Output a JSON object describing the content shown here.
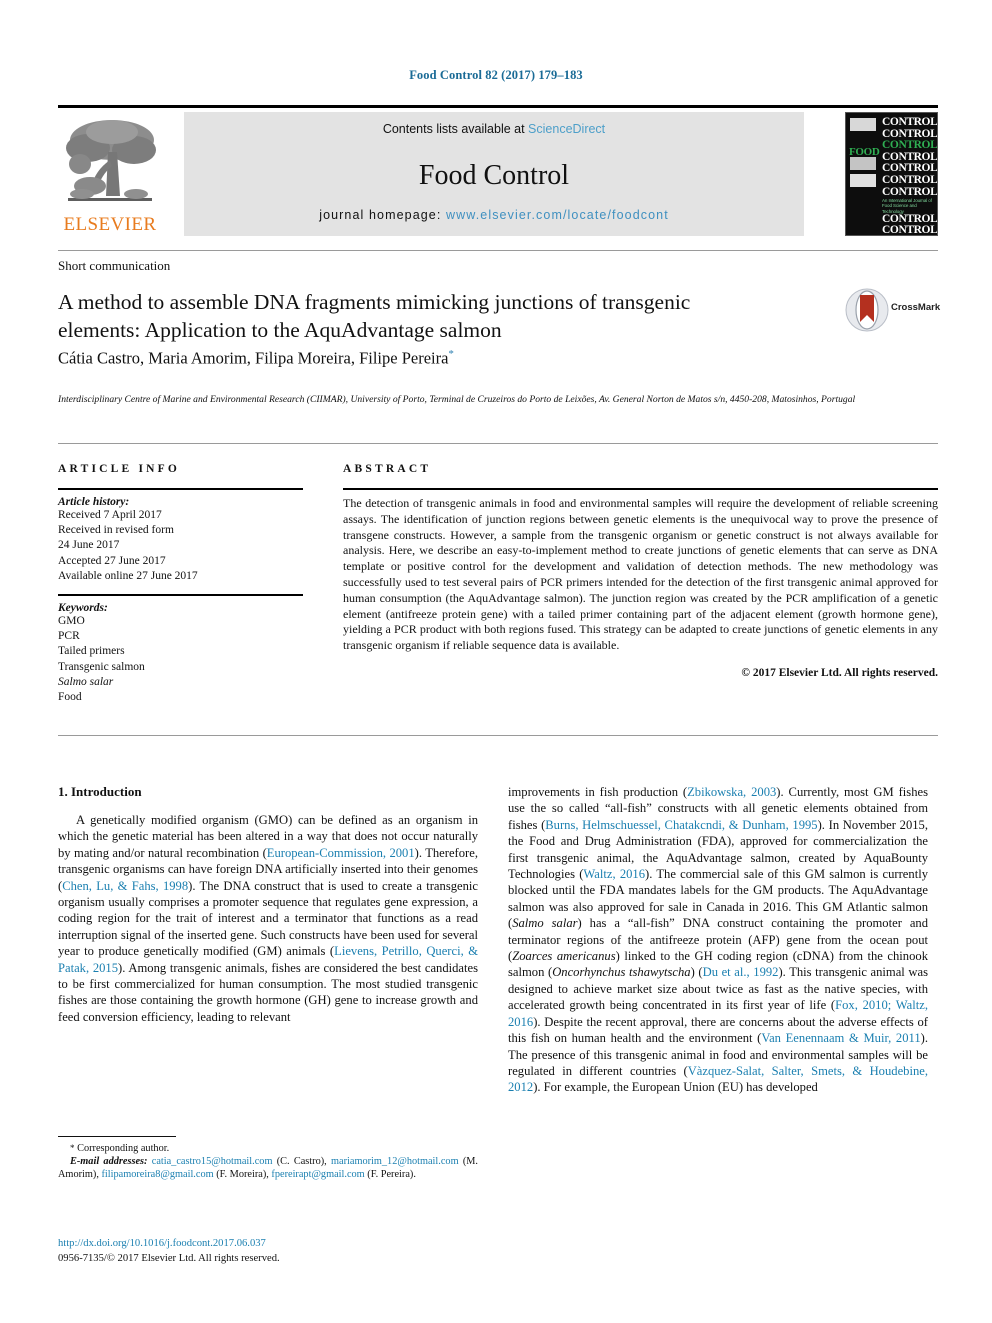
{
  "running_head": "Food Control 82 (2017) 179–183",
  "masthead": {
    "contents_prefix": "Contents lists available at ",
    "sciencedirect": "ScienceDirect",
    "journal_name": "Food Control",
    "homepage_prefix": "journal homepage: ",
    "homepage_url": "www.elsevier.com/locate/foodcont",
    "publisher_name": "ELSEVIER",
    "cover": {
      "word_food": "FOOD",
      "word_control": "CONTROL",
      "tagline": "An International Journal of Food Science and Technology"
    }
  },
  "article": {
    "type": "Short communication",
    "title": "A method to assemble DNA fragments mimicking junctions of transgenic elements: Application to the AquAdvantage salmon",
    "authors": "Cátia Castro, Maria Amorim, Filipa Moreira, Filipe Pereira",
    "corresponding_marker": "*",
    "affiliation": "Interdisciplinary Centre of Marine and Environmental Research (CIIMAR), University of Porto, Terminal de Cruzeiros do Porto de Leixões, Av. General Norton de Matos s/n, 4450-208, Matosinhos, Portugal",
    "crossmark_label": "CrossMark"
  },
  "info": {
    "heading": "ARTICLE INFO",
    "history_label": "Article history:",
    "history": [
      "Received 7 April 2017",
      "Received in revised form",
      "24 June 2017",
      "Accepted 27 June 2017",
      "Available online 27 June 2017"
    ],
    "keywords_label": "Keywords:",
    "keywords": [
      {
        "text": "GMO",
        "italic": false
      },
      {
        "text": "PCR",
        "italic": false
      },
      {
        "text": "Tailed primers",
        "italic": false
      },
      {
        "text": "Transgenic salmon",
        "italic": false
      },
      {
        "text": "Salmo salar",
        "italic": true
      },
      {
        "text": "Food",
        "italic": false
      }
    ]
  },
  "abstract": {
    "heading": "ABSTRACT",
    "text": "The detection of transgenic animals in food and environmental samples will require the development of reliable screening assays. The identification of junction regions between genetic elements is the unequivocal way to prove the presence of transgene constructs. However, a sample from the transgenic organism or genetic construct is not always available for analysis. Here, we describe an easy-to-implement method to create junctions of genetic elements that can serve as DNA template or positive control for the development and validation of detection methods. The new methodology was successfully used to test several pairs of PCR primers intended for the detection of the first transgenic animal approved for human consumption (the AquAdvantage salmon). The junction region was created by the PCR amplification of a genetic element (antifreeze protein gene) with a tailed primer containing part of the adjacent element (growth hormone gene), yielding a PCR product with both regions fused. This strategy can be adapted to create junctions of genetic elements in any transgenic organism if reliable sequence data is available.",
    "copyright": "© 2017 Elsevier Ltd. All rights reserved."
  },
  "body": {
    "section_number_title": "1. Introduction",
    "left_column_html": "A genetically modified organism (GMO) can be defined as an organism in which the genetic material has been altered in a way that does not occur naturally by mating and/or natural recombination (<span class=\"ref\">European-Commission, 2001</span>). Therefore, transgenic organisms can have foreign DNA artificially inserted into their genomes (<span class=\"ref\">Chen, Lu, &amp; Fahs, 1998</span>). The DNA construct that is used to create a transgenic organism usually comprises a promoter sequence that regulates gene expression, a coding region for the trait of interest and a terminator that functions as a read interruption signal of the inserted gene. Such constructs have been used for several year to produce genetically modified (GM) animals (<span class=\"ref\">Lievens, Petrillo, Querci, &amp; Patak, 2015</span>). Among transgenic animals, fishes are considered the best candidates to be first commercialized for human consumption. The most studied transgenic fishes are those containing the growth hormone (GH) gene to increase growth and feed conversion efficiency, leading to relevant",
    "right_column_html": "improvements in fish production (<span class=\"ref\">Zbikowska, 2003</span>). Currently, most GM fishes use the so called “all-fish” constructs with all genetic elements obtained from fishes (<span class=\"ref\">Burns, Helmschuessel, Chatakcndi, &amp; Dunham, 1995</span>). In November 2015, the Food and Drug Administration (FDA), approved for commercialization the first transgenic animal, the AquAdvantage salmon, created by AquaBounty Technologies (<span class=\"ref\">Waltz, 2016</span>). The commercial sale of this GM salmon is currently blocked until the FDA mandates labels for the GM products. The AquAdvantage salmon was also approved for sale in Canada in 2016. This GM Atlantic salmon (<span class=\"it\">Salmo salar</span>) has a “all-fish” DNA construct containing the promoter and terminator regions of the antifreeze protein (AFP) gene from the ocean pout (<span class=\"it\">Zoarces americanus</span>) linked to the GH coding region (cDNA) from the chinook salmon (<span class=\"it\">Oncorhynchus tshawytscha</span>) (<span class=\"ref\">Du et al., 1992</span>). This transgenic animal was designed to achieve market size about twice as fast as the native species, with accelerated growth being concentrated in its first year of life (<span class=\"ref\">Fox, 2010; Waltz, 2016</span>). Despite the recent approval, there are concerns about the adverse effects of this fish on human health and the environment (<span class=\"ref\">Van Eenennaam &amp; Muir, 2011</span>). The presence of this transgenic animal in food and environmental samples will be regulated in different countries (<span class=\"ref\">V&#224;zquez-Salat, Salter, Smets, &amp; Houdebine, 2012</span>). For example, the European Union (EU) has developed"
  },
  "footnote": {
    "corresponding_author": "Corresponding author.",
    "email_label": "E-mail addresses:",
    "emails_html": " <span class=\"doi-link\">catia_castro15@hotmail.com</span> (C. Castro), <span class=\"doi-link\">mariamorim_12@hotmail.com</span> (M. Amorim), <span class=\"doi-link\">filipamoreira8@gmail.com</span> (F. Moreira), <span class=\"doi-link\">fpereirapt@gmail.com</span> (F. Pereira)."
  },
  "footer": {
    "doi": "http://dx.doi.org/10.1016/j.foodcont.2017.06.037",
    "issn_line": "0956-7135/© 2017 Elsevier Ltd. All rights reserved."
  },
  "colors": {
    "link_blue": "#1a7fb0",
    "sd_blue": "#4d9fc9",
    "elsevier_orange": "#e87b1e",
    "cover_green": "#2fae52"
  }
}
